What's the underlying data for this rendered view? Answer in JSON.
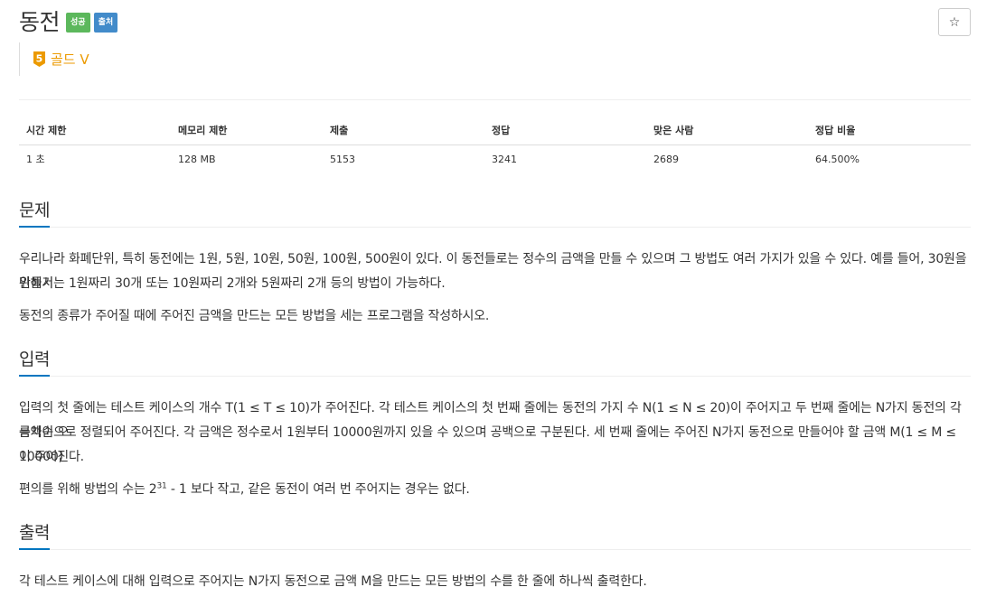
{
  "problem": {
    "title": "동전",
    "badges": {
      "success": "성공",
      "source": "출처"
    },
    "tier": {
      "level": "5",
      "label": "골드 V",
      "color": "#ec9a00"
    },
    "star_label": "☆"
  },
  "info_table": {
    "headers": [
      "시간 제한",
      "메모리 제한",
      "제출",
      "정답",
      "맞은 사람",
      "정답 비율"
    ],
    "values": [
      "1 초",
      "128 MB",
      "5153",
      "3241",
      "2689",
      "64.500%"
    ]
  },
  "sections": {
    "description": {
      "title": "문제",
      "p1_line1": "우리나라 화폐단위, 특히 동전에는 1원, 5원, 10원, 50원, 100원, 500원이 있다. 이 동전들로는 정수의 금액을 만들 수 있으며 그 방법도 여러 가지가 있을 수 있다. 예를 들어, 30원을 만들기",
      "p1_line2": "위해서는 1원짜리 30개 또는 10원짜리 2개와 5원짜리 2개 등의 방법이 가능하다.",
      "p2": "동전의 종류가 주어질 때에 주어진 금액을 만드는 모든 방법을 세는 프로그램을 작성하시오."
    },
    "input": {
      "title": "입력",
      "p1_line1": "입력의 첫 줄에는 테스트 케이스의 개수 T(1 ≤ T ≤ 10)가 주어진다. 각 테스트 케이스의 첫 번째 줄에는 동전의 가지 수 N(1 ≤ N ≤ 20)이 주어지고 두 번째 줄에는 N가지 동전의 각 금액이 오",
      "p1_line2": "름차순으로 정렬되어 주어진다. 각 금액은 정수로서 1원부터 10000원까지 있을 수 있으며 공백으로 구분된다. 세 번째 줄에는 주어진 N가지 동전으로 만들어야 할 금액 M(1 ≤ M ≤ 10000)",
      "p1_line3": "이 주어진다.",
      "p2_before": "편의를 위해 방법의 수는 2",
      "p2_exp": "31",
      "p2_after": " - 1 보다 작고, 같은 동전이 여러 번 주어지는 경우는 없다."
    },
    "output": {
      "title": "출력",
      "p1": "각 테스트 케이스에 대해 입력으로 주어지는 N가지 동전으로 금액 M을 만드는 모든 방법의 수를 한 줄에 하나씩 출력한다."
    }
  },
  "colors": {
    "accent": "#0076c0",
    "success": "#5cb85c",
    "source": "#428bca",
    "gold": "#ec9a00"
  }
}
